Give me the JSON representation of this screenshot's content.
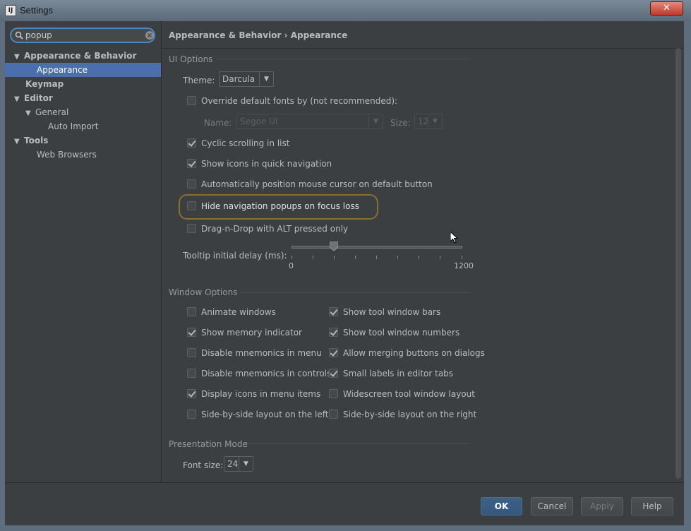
{
  "window": {
    "title": "Settings",
    "icon_glyph": "IJ",
    "close_glyph": "✕"
  },
  "search": {
    "value": "popup",
    "placeholder": ""
  },
  "tree": {
    "items": [
      {
        "label": "Appearance & Behavior",
        "expanded": true
      },
      {
        "label": "Appearance",
        "selected": true
      },
      {
        "label": "Keymap"
      },
      {
        "label": "Editor",
        "expanded": true
      },
      {
        "label": "General",
        "expanded": true
      },
      {
        "label": "Auto Import"
      },
      {
        "label": "Tools",
        "expanded": true
      },
      {
        "label": "Web Browsers"
      }
    ],
    "expand_glyph": "▼"
  },
  "breadcrumb": {
    "part1": "Appearance & Behavior",
    "separator": "›",
    "part2": "Appearance"
  },
  "ui_options": {
    "title": "UI Options",
    "theme_label": "Theme:",
    "theme_value": "Darcula",
    "override_fonts": {
      "label": "Override default fonts by (not recommended):",
      "checked": false
    },
    "name_label": "Name:",
    "name_value": "Segoe UI",
    "size_label": "Size:",
    "size_value": "12",
    "checkboxes": [
      {
        "label": "Cyclic scrolling in list",
        "checked": true
      },
      {
        "label": "Show icons in quick navigation",
        "checked": true
      },
      {
        "label": "Automatically position mouse cursor on default button",
        "checked": false
      },
      {
        "label": "Hide navigation popups on focus loss",
        "checked": false
      },
      {
        "label": "Drag-n-Drop with ALT pressed only",
        "checked": false
      }
    ],
    "tooltip_label": "Tooltip initial delay (ms):",
    "tooltip_min": "0",
    "tooltip_max": "1200",
    "tooltip_value": 300
  },
  "window_options": {
    "title": "Window Options",
    "left": [
      {
        "label": "Animate windows",
        "checked": false
      },
      {
        "label": "Show memory indicator",
        "checked": true
      },
      {
        "label": "Disable mnemonics in menu",
        "checked": false
      },
      {
        "label": "Disable mnemonics in controls",
        "checked": false
      },
      {
        "label": "Display icons in menu items",
        "checked": true
      },
      {
        "label": "Side-by-side layout on the left",
        "checked": false
      }
    ],
    "right": [
      {
        "label": "Show tool window bars",
        "checked": true
      },
      {
        "label": "Show tool window numbers",
        "checked": true
      },
      {
        "label": "Allow merging buttons on dialogs",
        "checked": true
      },
      {
        "label": "Small labels in editor tabs",
        "checked": true
      },
      {
        "label": "Widescreen tool window layout",
        "checked": false
      },
      {
        "label": "Side-by-side layout on the right",
        "checked": false
      }
    ]
  },
  "presentation_mode": {
    "title": "Presentation Mode",
    "font_size_label": "Font size:",
    "font_size_value": "24"
  },
  "buttons": {
    "ok": "OK",
    "cancel": "Cancel",
    "apply": "Apply",
    "help": "Help"
  },
  "colors": {
    "selection": "#4b6eaf",
    "accent": "#4a88c7",
    "highlight_ring": "#8a6e2e"
  },
  "icons": {
    "arrow_glyph": "▼"
  }
}
